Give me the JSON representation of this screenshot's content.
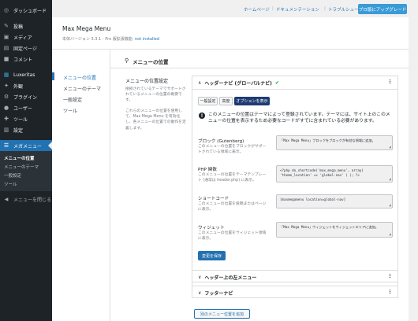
{
  "sidebar": {
    "items": [
      {
        "label": "ダッシュボード",
        "icon": "dashboard-icon",
        "glyph": "◎"
      },
      {
        "label": "投稿",
        "icon": "pin-icon",
        "glyph": "✎"
      },
      {
        "label": "メディア",
        "icon": "media-icon",
        "glyph": "▣"
      },
      {
        "label": "固定ページ",
        "icon": "page-icon",
        "glyph": "▤"
      },
      {
        "label": "コメント",
        "icon": "comment-icon",
        "glyph": "■"
      },
      {
        "label": "Luxeritas",
        "icon": "theme-icon",
        "glyph": "▦"
      },
      {
        "label": "外観",
        "icon": "appearance-icon",
        "glyph": "✦"
      },
      {
        "label": "プラグイン",
        "icon": "plugin-icon",
        "glyph": "⚙"
      },
      {
        "label": "ユーザー",
        "icon": "user-icon",
        "glyph": "●"
      },
      {
        "label": "ツール",
        "icon": "tools-icon",
        "glyph": "✚"
      },
      {
        "label": "設定",
        "icon": "settings-icon",
        "glyph": "▥"
      },
      {
        "label": "メガメニュー",
        "icon": "megamenu-icon",
        "glyph": "☰"
      }
    ],
    "submenu": [
      "メニューの位置",
      "メニューのテーマ",
      "一般設定",
      "ツール"
    ],
    "collapse_label": "メニューを閉じる",
    "collapse_glyph": "◀"
  },
  "helpbar": {
    "links": [
      "ホームページ",
      "ドキュメンテーション",
      "トラブルシューティング"
    ],
    "upgrade_label": "プロ版にアップグレード"
  },
  "plugin": {
    "title": "Max Mega Menu",
    "version_text": "本体バージョン 3.3.1 - Pro 版拡張機能: ",
    "not_installed": "not installed"
  },
  "tabs": [
    "メニューの位置",
    "メニューのテーマ",
    "一般設定",
    "ツール"
  ],
  "section": {
    "pin_glyph": "⚲",
    "title": "メニューの位置",
    "settings_label": "メニューの位置設定",
    "desc1": "接続されているテーマでサポートされているメニューの位置の概要です。",
    "desc2": "これらのメニューの位置を使用して、Max Mega Menu を有効化し、各メニューの位置での動作を定義します。"
  },
  "locations": {
    "header_nav": {
      "title": "ヘッダーナビ (グローバルナビ)",
      "check": "✔",
      "chevron": "∧",
      "kebab": "⋮",
      "subtabs": [
        "一般設定",
        "高度",
        "オプションを表示"
      ],
      "notice_icon": "!",
      "notice": "このメニューの位置はテーマによって登録されています。テーマには、サイト上のこのメニューの位置を表示するため必要なコードがすでに含まれている必要があります。",
      "rows": [
        {
          "title": "ブロック (Gutenberg)",
          "desc": "このメニューの位置をブロックがサポートされている領域に表示。",
          "code": "「Max Mega Menu」ブロックをブロックが有効な領域に追加。"
        },
        {
          "title": "PHP 関数",
          "desc": "このメニューの位置をテーマテンプレート (通常は header.php) に表示。",
          "code": "<?php do_shortcode('max_mega_menu', array( 'theme_location' => 'global-nav' ) ); ?>"
        },
        {
          "title": "ショートコード",
          "desc": "このメニューの位置を投稿またはページに表示。",
          "code": "[maxmegamenu location=global-nav]"
        },
        {
          "title": "ウィジェット",
          "desc": "このメニューの位置をウィジェット領域に表示。",
          "code": "「Max Mega Menu」ウィジェットをウィジェットエリアに追加。"
        }
      ],
      "save_label": "変更を保存",
      "grip": "◢"
    },
    "upper_menu": {
      "title": "ヘッダー上の左メニュー",
      "chevron": "∨",
      "kebab": "⋮"
    },
    "footer_nav": {
      "title": "フッターナビ",
      "chevron": "∨",
      "kebab": "⋮"
    }
  },
  "add_location_label": "別のメニュー位置を追加"
}
